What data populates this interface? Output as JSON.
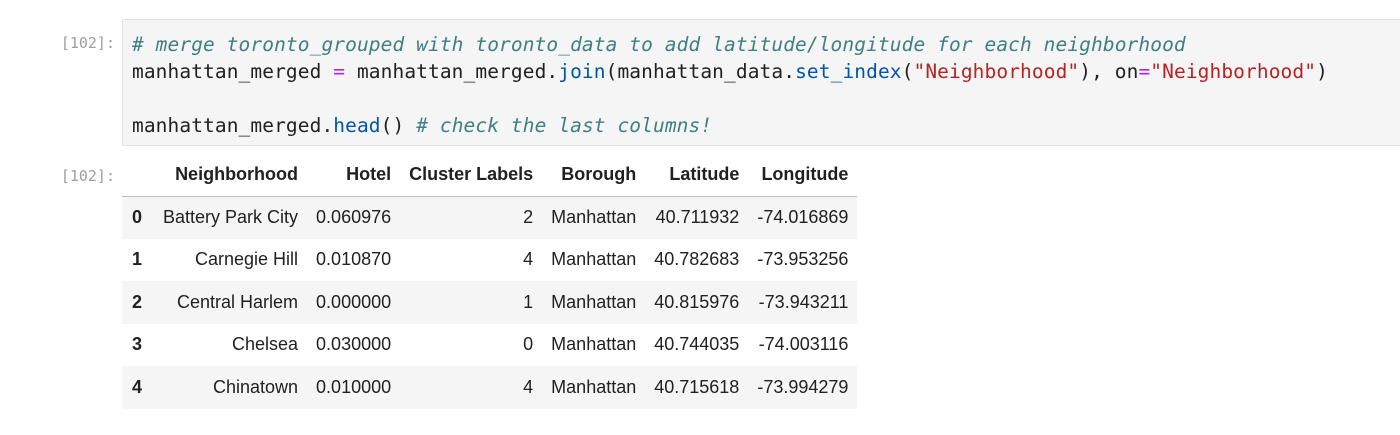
{
  "input_cell": {
    "prompt": "[102]:",
    "lines": [
      [
        {
          "t": "# merge toronto_grouped with toronto_data to add latitude/longitude for each neighborhood",
          "c": "comment"
        }
      ],
      [
        {
          "t": "manhattan_merged ",
          "c": "kw"
        },
        {
          "t": "=",
          "c": "op"
        },
        {
          "t": " manhattan_merged.",
          "c": "kw"
        },
        {
          "t": "join",
          "c": "fn"
        },
        {
          "t": "(manhattan_data.",
          "c": "kw"
        },
        {
          "t": "set_index",
          "c": "fn"
        },
        {
          "t": "(",
          "c": "kw"
        },
        {
          "t": "\"Neighborhood\"",
          "c": "str"
        },
        {
          "t": "), on",
          "c": "kw"
        },
        {
          "t": "=",
          "c": "op"
        },
        {
          "t": "\"Neighborhood\"",
          "c": "str"
        },
        {
          "t": ")",
          "c": "kw"
        }
      ],
      [],
      [
        {
          "t": "manhattan_merged.",
          "c": "kw"
        },
        {
          "t": "head",
          "c": "fn"
        },
        {
          "t": "() ",
          "c": "kw"
        },
        {
          "t": "# check the last columns!",
          "c": "comment"
        }
      ]
    ]
  },
  "output_cell": {
    "prompt": "[102]:",
    "table": {
      "columns": [
        "",
        "Neighborhood",
        "Hotel",
        "Cluster Labels",
        "Borough",
        "Latitude",
        "Longitude"
      ],
      "rows": [
        [
          "0",
          "Battery Park City",
          "0.060976",
          "2",
          "Manhattan",
          "40.711932",
          "-74.016869"
        ],
        [
          "1",
          "Carnegie Hill",
          "0.010870",
          "4",
          "Manhattan",
          "40.782683",
          "-73.953256"
        ],
        [
          "2",
          "Central Harlem",
          "0.000000",
          "1",
          "Manhattan",
          "40.815976",
          "-73.943211"
        ],
        [
          "3",
          "Chelsea",
          "0.030000",
          "0",
          "Manhattan",
          "40.744035",
          "-74.003116"
        ],
        [
          "4",
          "Chinatown",
          "0.010000",
          "4",
          "Manhattan",
          "40.715618",
          "-73.994279"
        ]
      ]
    }
  }
}
